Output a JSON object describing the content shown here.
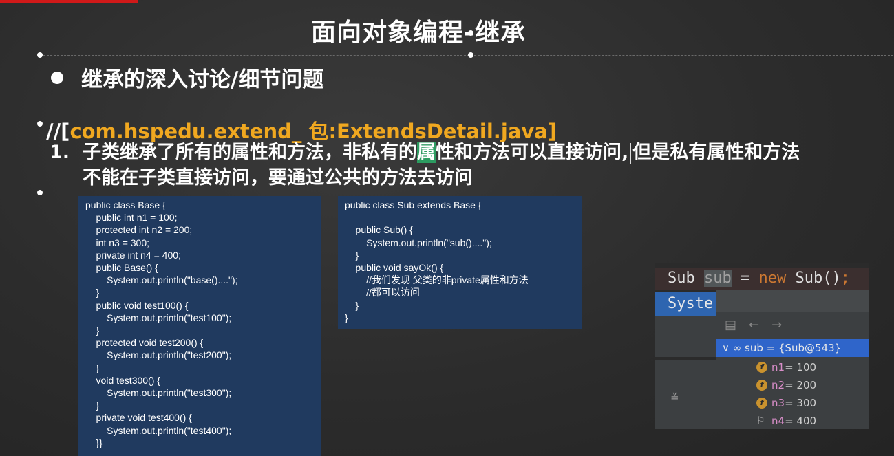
{
  "slide": {
    "title": "面向对象编程-继承",
    "bullet": "继承的深入讨论/细节问题",
    "package_prefix": "//[",
    "package_highlight": "com.hspedu.extend_ 包:ExtendsDetail.java]",
    "point1_num": "1.",
    "point1_part_a": "子类继承了所有的属性和方法，非私有的",
    "point1_highlight_char": "属",
    "point1_part_b": "性和方法可以直接访问,",
    "point1_part_c": "但是私有属性和方法",
    "point1_line2": "不能在子类直接访问，要通过公共的方法去访问"
  },
  "code_base": "public class Base {\n    public int n1 = 100;\n    protected int n2 = 200;\n    int n3 = 300;\n    private int n4 = 400;\n    public Base() {\n        System.out.println(\"base()....\");\n    }\n    public void test100() {\n        System.out.println(\"test100\");\n    }\n    protected void test200() {\n        System.out.println(\"test200\");\n    }\n    void test300() {\n        System.out.println(\"test300\");\n    }\n    private void test400() {\n        System.out.println(\"test400\");\n    }}",
  "code_sub": "public class Sub extends Base {\n\n    public Sub() {\n        System.out.println(\"sub()....\");\n    }\n    public void sayOk() {\n        //我们发现 父类的非private属性和方法\n        //都可以访问\n    }\n}",
  "ide": {
    "line1_type": "Sub ",
    "line1_var": "sub",
    "line1_eq": " = ",
    "line1_new": "new",
    "line1_ctor": " Sub()",
    "line1_semi": ";",
    "line2": "Syste",
    "toolbar_icons": [
      "folder-icon",
      "back-arrow-icon",
      "forward-arrow-icon"
    ],
    "selected_label": "∨  ∞ sub = {Sub@543}",
    "fields": [
      {
        "icon": "field-icon",
        "name": "n1",
        "value": " = 100"
      },
      {
        "icon": "field-icon",
        "name": "n2",
        "value": " = 200"
      },
      {
        "icon": "field-icon",
        "name": "n3",
        "value": " = 300"
      },
      {
        "icon": "flag-icon",
        "name": "n4",
        "value": " = 400"
      }
    ]
  }
}
